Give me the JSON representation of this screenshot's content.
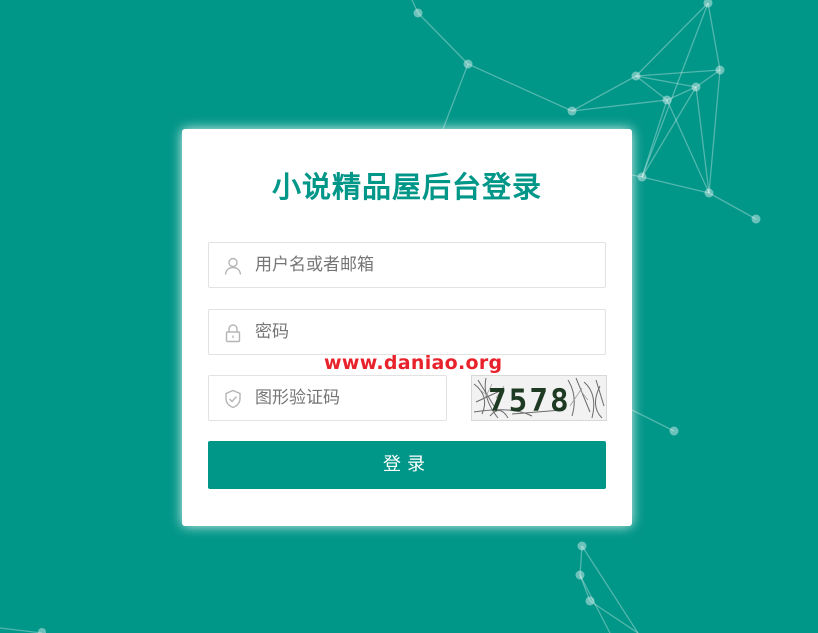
{
  "page": {
    "title": "小说精品屋后台登录",
    "watermark": "www.daniao.org"
  },
  "form": {
    "username_placeholder": "用户名或者邮箱",
    "password_placeholder": "密码",
    "captcha_placeholder": "图形验证码",
    "captcha_code": "7578",
    "submit_label": "登录"
  },
  "theme": {
    "primary": "#009688",
    "watermark": "#e8222b"
  },
  "icons": {
    "username": "user-icon",
    "password": "lock-icon",
    "captcha": "shield-icon"
  }
}
